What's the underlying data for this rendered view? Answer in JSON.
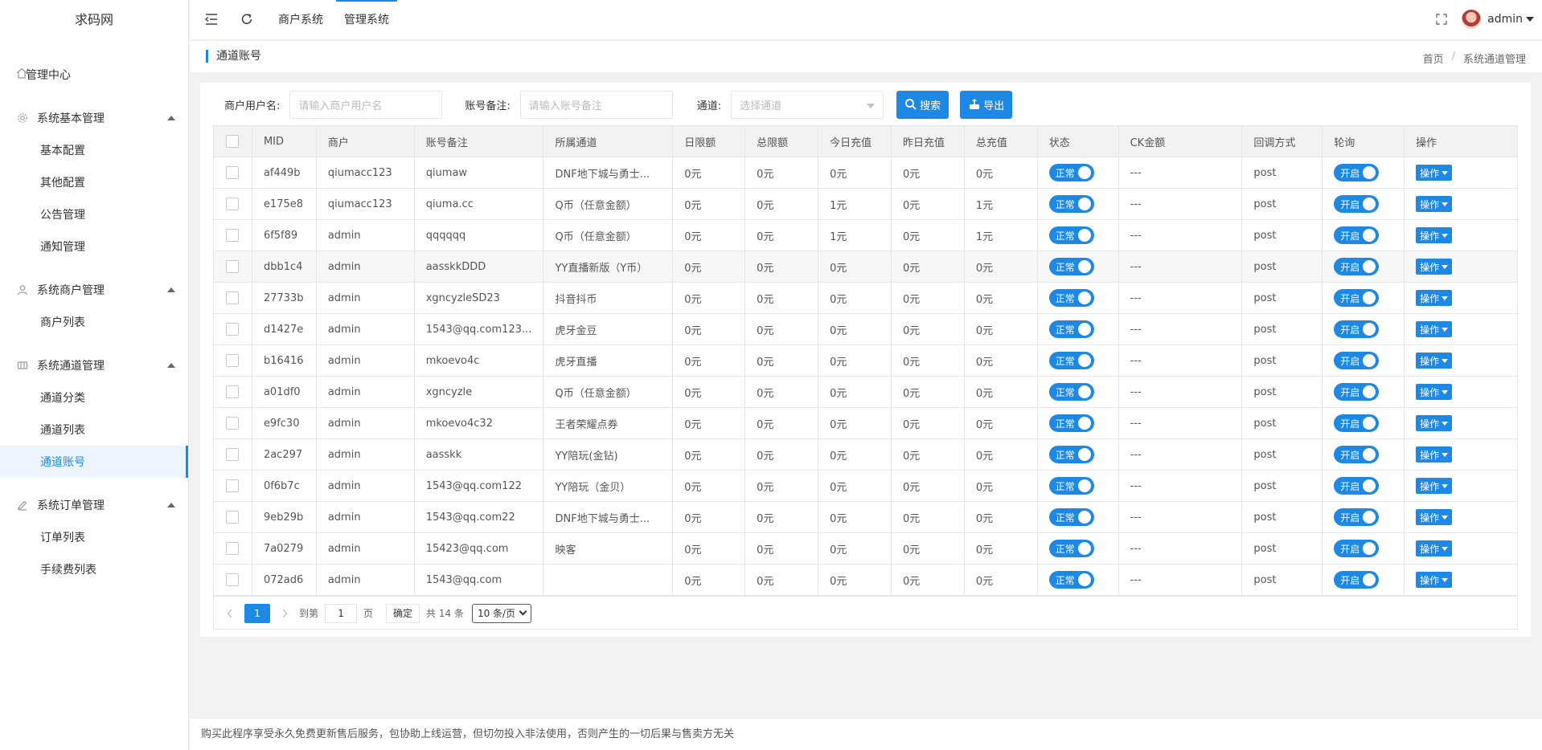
{
  "app": {
    "logo": "求码网"
  },
  "sidebar": {
    "home": "管理中心",
    "groups": [
      {
        "label": "系统基本管理",
        "items": [
          "基本配置",
          "其他配置",
          "公告管理",
          "通知管理"
        ]
      },
      {
        "label": "系统商户管理",
        "items": [
          "商户列表"
        ]
      },
      {
        "label": "系统通道管理",
        "items": [
          "通道分类",
          "通道列表",
          "通道账号"
        ]
      },
      {
        "label": "系统订单管理",
        "items": [
          "订单列表",
          "手续费列表"
        ]
      }
    ],
    "active_item": "通道账号"
  },
  "topbar": {
    "tabs": [
      "商户系统",
      "管理系统"
    ],
    "active_tab": "管理系统",
    "user": "admin"
  },
  "page": {
    "title": "通道账号",
    "breadcrumb": [
      "首页",
      "系统通道管理"
    ],
    "breadcrumb_sep": "/"
  },
  "search": {
    "merchant_label": "商户用户名:",
    "merchant_placeholder": "请输入商户用户名",
    "remark_label": "账号备注:",
    "remark_placeholder": "请输入账号备注",
    "channel_label": "通道:",
    "channel_placeholder": "选择通道",
    "search_btn": "搜索",
    "export_btn": "导出"
  },
  "table": {
    "columns": [
      "MID",
      "商户",
      "账号备注",
      "所属通道",
      "日限额",
      "总限额",
      "今日充值",
      "昨日充值",
      "总充值",
      "状态",
      "CK金额",
      "回调方式",
      "轮询",
      "操作"
    ],
    "status_label": "正常",
    "poll_label": "开启",
    "op_label": "操作",
    "rows": [
      [
        "af449b",
        "qiumacc123",
        "qiumaw",
        "DNF地下城与勇士...",
        "0元",
        "0元",
        "0元",
        "0元",
        "0元",
        "---",
        "post"
      ],
      [
        "e175e8",
        "qiumacc123",
        "qiuma.cc",
        "Q币（任意金额）",
        "0元",
        "0元",
        "1元",
        "0元",
        "1元",
        "---",
        "post"
      ],
      [
        "6f5f89",
        "admin",
        "qqqqqq",
        "Q币（任意金额）",
        "0元",
        "0元",
        "1元",
        "0元",
        "1元",
        "---",
        "post"
      ],
      [
        "dbb1c4",
        "admin",
        "aasskkDDD",
        "YY直播新版（Y币）",
        "0元",
        "0元",
        "0元",
        "0元",
        "0元",
        "---",
        "post"
      ],
      [
        "27733b",
        "admin",
        "xgncyzleSD23",
        "抖音抖币",
        "0元",
        "0元",
        "0元",
        "0元",
        "0元",
        "---",
        "post"
      ],
      [
        "d1427e",
        "admin",
        "1543@qq.com123...",
        "虎牙金豆",
        "0元",
        "0元",
        "0元",
        "0元",
        "0元",
        "---",
        "post"
      ],
      [
        "b16416",
        "admin",
        "mkoevo4c",
        "虎牙直播",
        "0元",
        "0元",
        "0元",
        "0元",
        "0元",
        "---",
        "post"
      ],
      [
        "a01df0",
        "admin",
        "xgncyzle",
        "Q币（任意金额）",
        "0元",
        "0元",
        "0元",
        "0元",
        "0元",
        "---",
        "post"
      ],
      [
        "e9fc30",
        "admin",
        "mkoevo4c32",
        "王者荣耀点券",
        "0元",
        "0元",
        "0元",
        "0元",
        "0元",
        "---",
        "post"
      ],
      [
        "2ac297",
        "admin",
        "aasskk",
        "YY陪玩(金钻)",
        "0元",
        "0元",
        "0元",
        "0元",
        "0元",
        "---",
        "post"
      ],
      [
        "0f6b7c",
        "admin",
        "1543@qq.com122",
        "YY陪玩（金贝）",
        "0元",
        "0元",
        "0元",
        "0元",
        "0元",
        "---",
        "post"
      ],
      [
        "9eb29b",
        "admin",
        "1543@qq.com22",
        "DNF地下城与勇士...",
        "0元",
        "0元",
        "0元",
        "0元",
        "0元",
        "---",
        "post"
      ],
      [
        "7a0279",
        "admin",
        "15423@qq.com",
        "映客",
        "0元",
        "0元",
        "0元",
        "0元",
        "0元",
        "---",
        "post"
      ],
      [
        "072ad6",
        "admin",
        "1543@qq.com",
        "",
        "0元",
        "0元",
        "0元",
        "0元",
        "0元",
        "---",
        "post"
      ]
    ]
  },
  "pager": {
    "current": "1",
    "goto_label": "到第",
    "goto_value": "1",
    "page_unit": "页",
    "confirm": "确定",
    "total": "共 14 条",
    "page_size": "10 条/页"
  },
  "footer": {
    "text": "购买此程序享受永久免费更新售后服务，包协助上线运营，但切勿投入非法使用，否则产生的一切后果与售卖方无关"
  },
  "colors": {
    "accent": "#1e88e5"
  }
}
